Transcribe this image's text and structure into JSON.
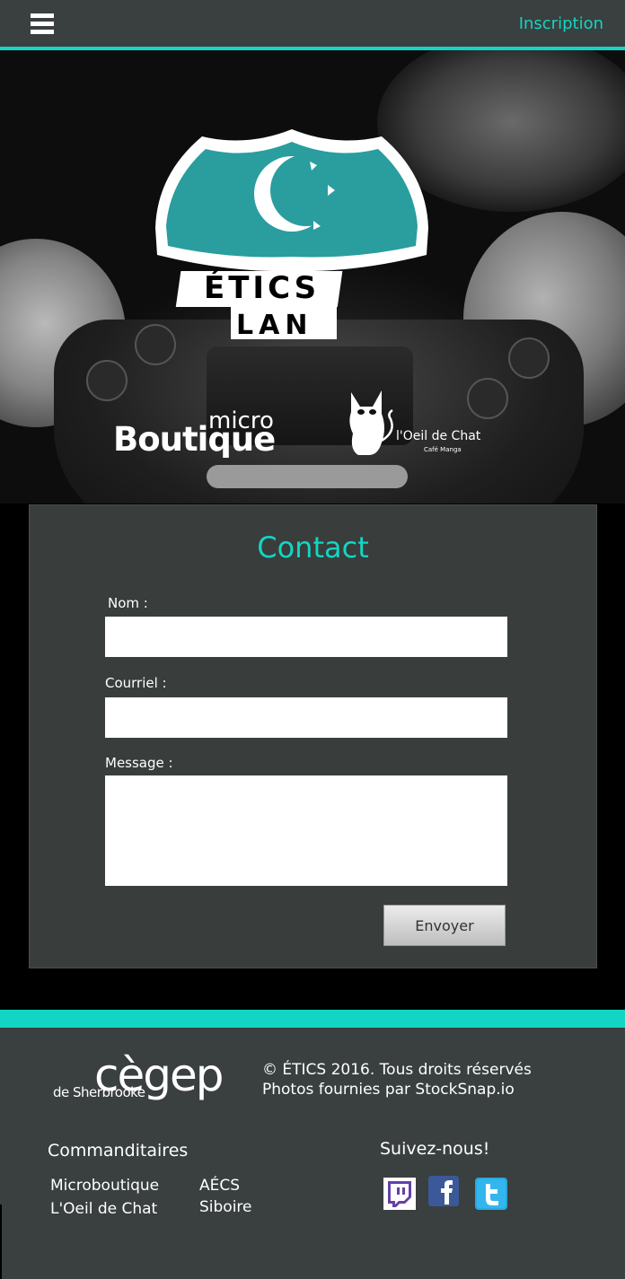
{
  "nav": {
    "signup_label": "Inscription"
  },
  "hero": {
    "logo_line1": "ÉTICS",
    "logo_line2": "LAN",
    "sponsor1_small": "micro",
    "sponsor1_big": "Boutique",
    "sponsor2_name": "l'Oeil de Chat",
    "sponsor2_tagline": "Café Manga"
  },
  "contact": {
    "title": "Contact",
    "name_label": "Nom :",
    "email_label": "Courriel :",
    "message_label": "Message :",
    "name_value": "",
    "email_value": "",
    "message_value": "",
    "send_label": "Envoyer"
  },
  "footer": {
    "cegep_big": "cègep",
    "cegep_small": "de Sherbrooke",
    "copyright_line1": "© ÉTICS 2016. Tous droits réservés",
    "copyright_line2": "Photos fournies par StockSnap.io",
    "sponsors_title": "Commanditaires",
    "sponsors": [
      "Microboutique",
      "L'Oeil de Chat",
      "AÉCS",
      "Siboire"
    ],
    "follow_title": "Suivez-nous!",
    "social": [
      "twitch-icon",
      "facebook-icon",
      "twitter-icon"
    ]
  },
  "colors": {
    "accent": "#12d6c3",
    "panel": "#393d3c",
    "bar": "#3a3f3f"
  }
}
